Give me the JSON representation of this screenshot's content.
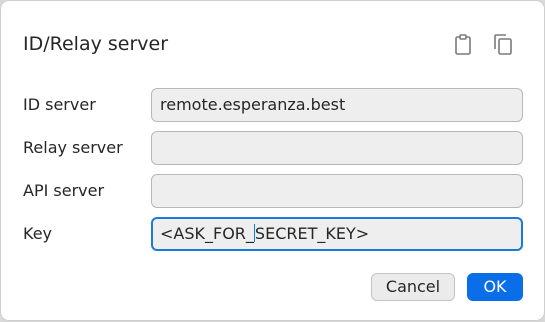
{
  "dialog": {
    "title": "ID/Relay server",
    "header_icons": [
      "clipboard-paste-icon",
      "copy-icon"
    ]
  },
  "fields": {
    "id_server": {
      "label": "ID server",
      "value": "remote.esperanza.best"
    },
    "relay_server": {
      "label": "Relay server",
      "value": ""
    },
    "api_server": {
      "label": "API server",
      "value": ""
    },
    "key": {
      "label": "Key",
      "value_before_caret": "<ASK_FOR_",
      "value_after_caret": "SECRET_KEY>"
    }
  },
  "buttons": {
    "cancel_label": "Cancel",
    "ok_label": "OK"
  },
  "colors": {
    "accent": "#0a6ee8",
    "focus_border": "#1a7ad9",
    "field_bg": "#eeeeee",
    "text": "#262626"
  }
}
